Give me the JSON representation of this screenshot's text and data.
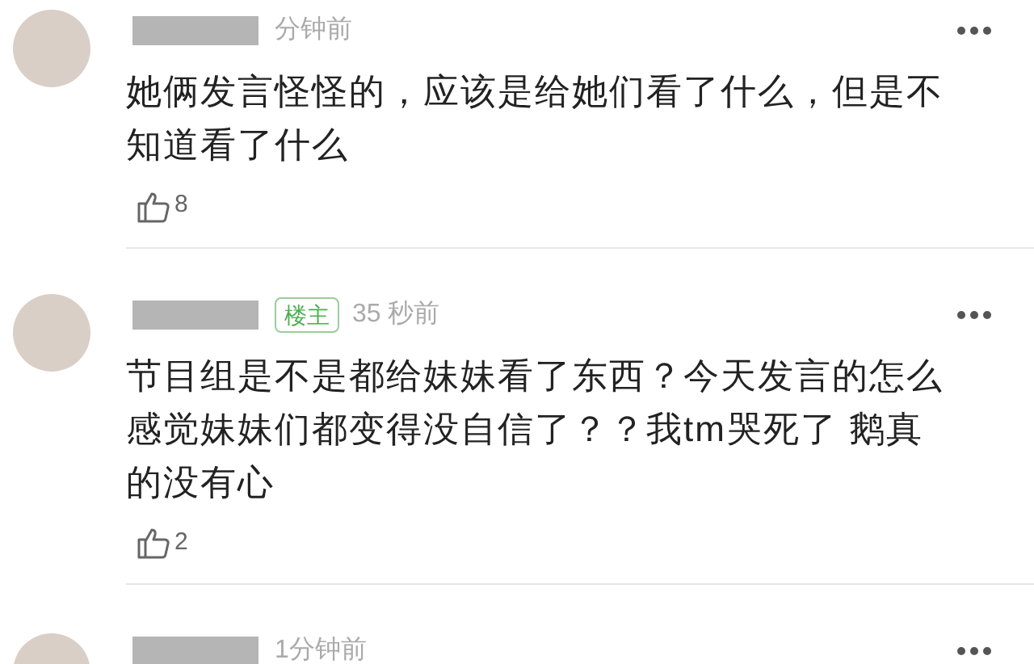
{
  "comments": [
    {
      "time": "分钟前",
      "text": "她俩发言怪怪的，应该是给她们看了什么，但是不知道看了什么",
      "likes": "8"
    },
    {
      "time": "35 秒前",
      "author_badge": "楼主",
      "text": "节目组是不是都给妹妹看了东西？今天发言的怎么感觉妹妹们都变得没自信了？？我tm哭死了 鹅真的没有心",
      "likes": "2"
    },
    {
      "time": "1分钟前"
    }
  ]
}
